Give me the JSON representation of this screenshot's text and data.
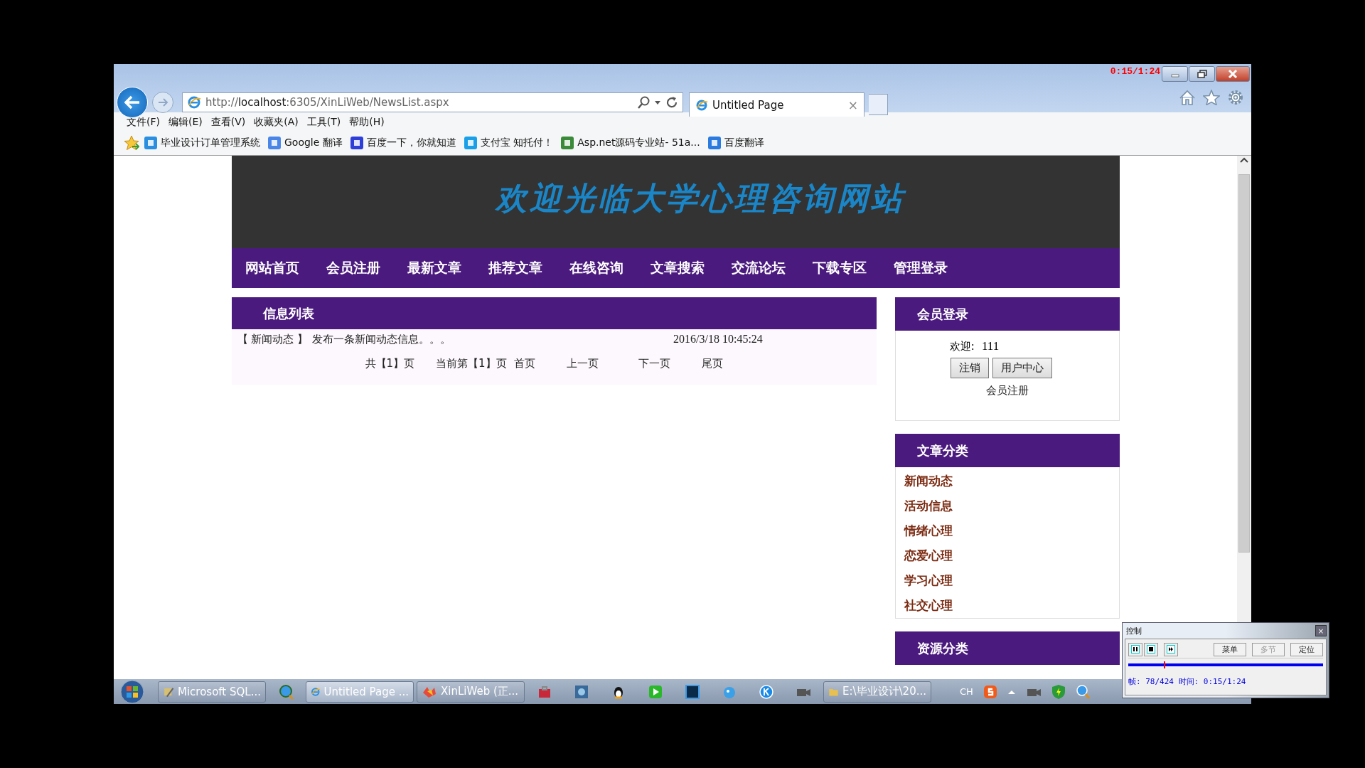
{
  "video_timer": "0:15/1:24",
  "browser": {
    "address": {
      "scheme": "http://",
      "host": "localhost",
      "rest": ":6305/XinLiWeb/NewsList.aspx"
    },
    "tab": {
      "title": "Untitled Page",
      "close": "×",
      "selected": true
    },
    "menu": [
      "文件(F)",
      "编辑(E)",
      "查看(V)",
      "收藏夹(A)",
      "工具(T)",
      "帮助(H)"
    ],
    "favorites": [
      "毕业设计订单管理系统",
      "Google 翻译",
      "百度一下，你就知道",
      "支付宝 知托付！",
      "Asp.net源码专业站- 51a...",
      "百度翻译"
    ]
  },
  "site": {
    "title": "欢迎光临大学心理咨询网站",
    "nav": [
      "网站首页",
      "会员注册",
      "最新文章",
      "推荐文章",
      "在线咨询",
      "文章搜索",
      "交流论坛",
      "下载专区",
      "管理登录"
    ],
    "info_list": {
      "title": "信息列表",
      "items": [
        {
          "category": "【 新闻动态 】",
          "title": "发布一条新闻动态信息。。。",
          "date": "2016/3/18 10:45:24"
        }
      ],
      "pager": [
        "共【1】页",
        "当前第【1】页",
        "首页",
        "上一页",
        "下一页",
        "尾页"
      ]
    },
    "member": {
      "title": "会员登录",
      "welcome_label": "欢迎:",
      "username": "111",
      "buttons": [
        "注销",
        "用户中心"
      ],
      "register_link": "会员注册"
    },
    "categories": {
      "title": "文章分类",
      "items": [
        "新闻动态",
        "活动信息",
        "情绪心理",
        "恋爱心理",
        "学习心理",
        "社交心理"
      ]
    },
    "resources": {
      "title": "资源分类"
    }
  },
  "taskbar": {
    "windows": [
      {
        "label": "Microsoft SQL...",
        "selected": false
      },
      {
        "label": "Untitled Page ...",
        "selected": true
      },
      {
        "label": "XinLiWeb (正...",
        "selected": false
      },
      {
        "label": "E:\\毕业设计\\20...",
        "selected": false
      }
    ],
    "language": "CH"
  },
  "player": {
    "title": "控制",
    "close": "×",
    "buttons": [
      {
        "label": "菜单",
        "disabled": false
      },
      {
        "label": "多节",
        "disabled": true
      },
      {
        "label": "定位",
        "disabled": false
      }
    ],
    "level": 0.184,
    "status": "帧: 78/424 时间: 0:15/1:24"
  }
}
